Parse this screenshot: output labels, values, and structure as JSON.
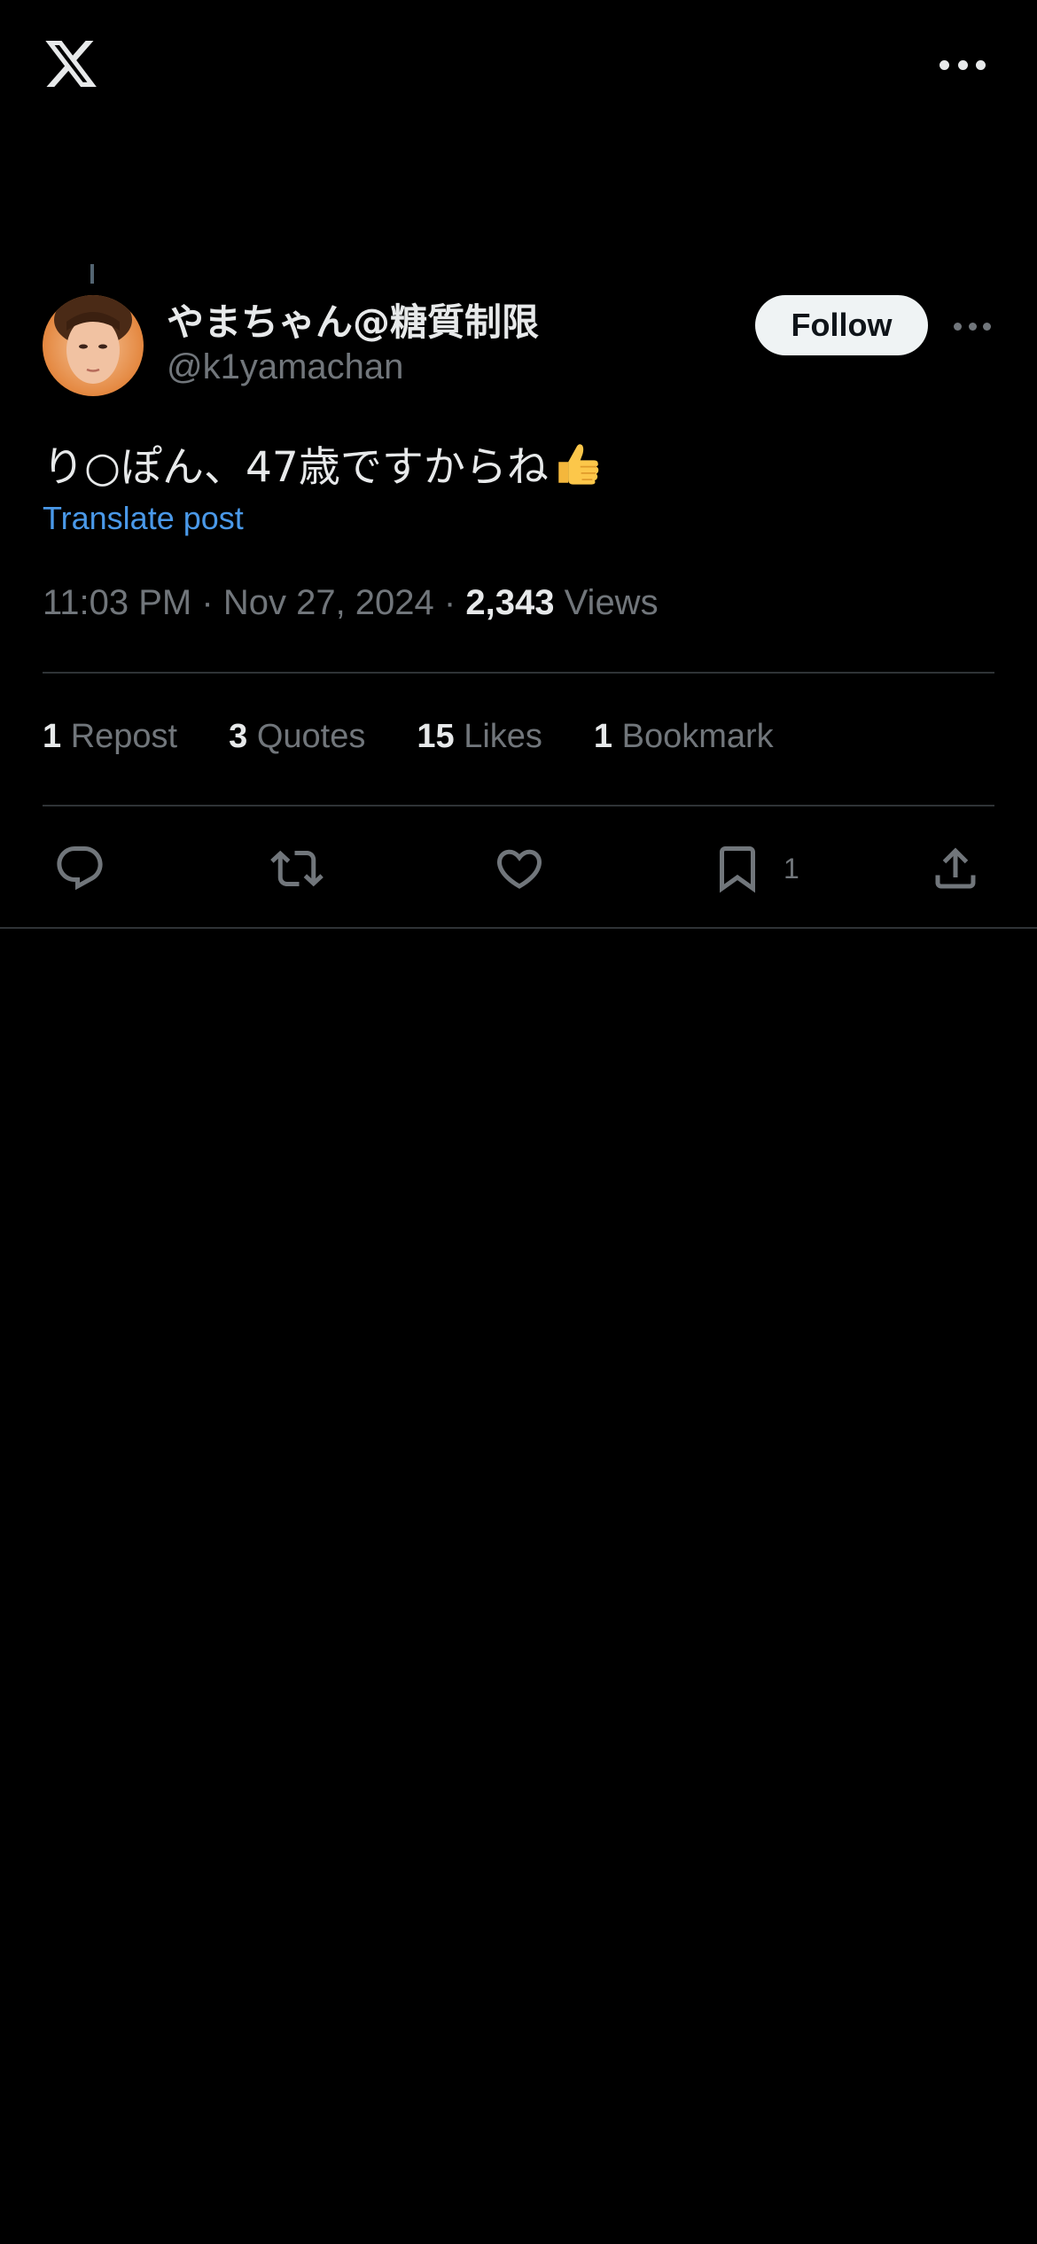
{
  "header": {
    "logo_icon": "x-logo-icon",
    "more_icon": "more-horizontal-icon"
  },
  "author": {
    "display_name": "やまちゃん@糖質制限",
    "handle": "@k1yamachan",
    "follow_label": "Follow"
  },
  "tweet": {
    "text": "り○ぽん、47歳ですからね",
    "emoji_icon": "thumbs-up-emoji",
    "translate_label": "Translate post",
    "time": "11:03 PM",
    "date": "Nov 27, 2024",
    "separator": "·",
    "views_count": "2,343",
    "views_label": "Views"
  },
  "stats": {
    "reposts_count": "1",
    "reposts_label": "Repost",
    "quotes_count": "3",
    "quotes_label": "Quotes",
    "likes_count": "15",
    "likes_label": "Likes",
    "bookmarks_count": "1",
    "bookmarks_label": "Bookmark"
  },
  "actions": {
    "bookmark_count": "1"
  },
  "colors": {
    "background": "#000000",
    "text_primary": "#e7e9ea",
    "text_secondary": "#71767b",
    "link": "#4a99e9",
    "divider": "#2f3336",
    "follow_bg": "#eff3f4"
  }
}
